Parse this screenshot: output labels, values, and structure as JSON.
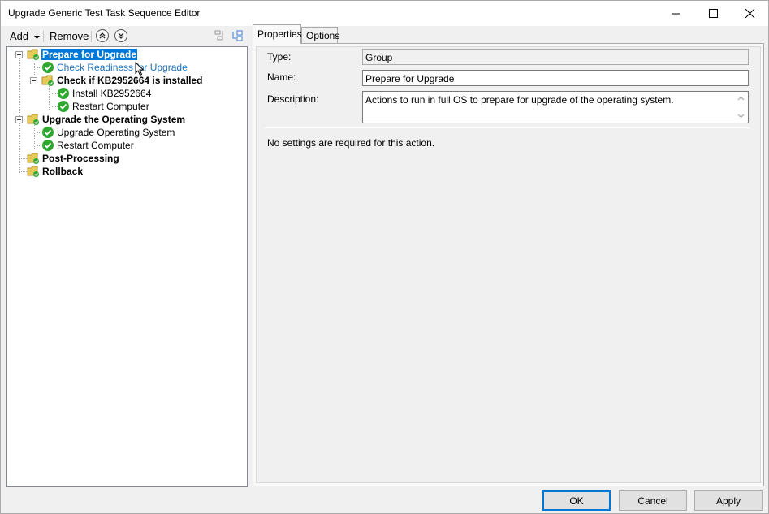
{
  "window": {
    "title": "Upgrade Generic Test Task Sequence Editor",
    "minimize_icon": "minimize-icon",
    "maximize_icon": "maximize-icon",
    "close_icon": "close-icon"
  },
  "toolbar": {
    "add_label": "Add",
    "remove_label": "Remove",
    "move_up_icon": "move-up-icon",
    "move_down_icon": "move-down-icon"
  },
  "tree": {
    "items": [
      {
        "label": "Prepare for Upgrade",
        "type": "group",
        "bold": true,
        "selected": true
      },
      {
        "label": "Check Readiness for Upgrade",
        "type": "step",
        "hover": true
      },
      {
        "label": "Check if KB2952664 is installed",
        "type": "group",
        "bold": true
      },
      {
        "label": "Install KB2952664",
        "type": "step"
      },
      {
        "label": "Restart Computer",
        "type": "step"
      },
      {
        "label": "Upgrade the Operating System",
        "type": "group",
        "bold": true
      },
      {
        "label": "Upgrade Operating System",
        "type": "step"
      },
      {
        "label": "Restart Computer",
        "type": "step"
      },
      {
        "label": "Post-Processing",
        "type": "group",
        "bold": true
      },
      {
        "label": "Rollback",
        "type": "group",
        "bold": true
      }
    ]
  },
  "tabs": [
    {
      "label": "Properties",
      "active": true
    },
    {
      "label": "Options",
      "active": false
    }
  ],
  "properties": {
    "type_label": "Type:",
    "type_value": "Group",
    "name_label": "Name:",
    "name_value": "Prepare for Upgrade",
    "description_label": "Description:",
    "description_value": "Actions to run in full OS to prepare for upgrade of the operating system.",
    "note": "No settings are required  for this action."
  },
  "buttons": {
    "ok": "OK",
    "cancel": "Cancel",
    "apply": "Apply"
  },
  "colors": {
    "selection": "#0078d7",
    "check_green": "#2fa82f",
    "folder_yellow": "#e8c95a"
  }
}
